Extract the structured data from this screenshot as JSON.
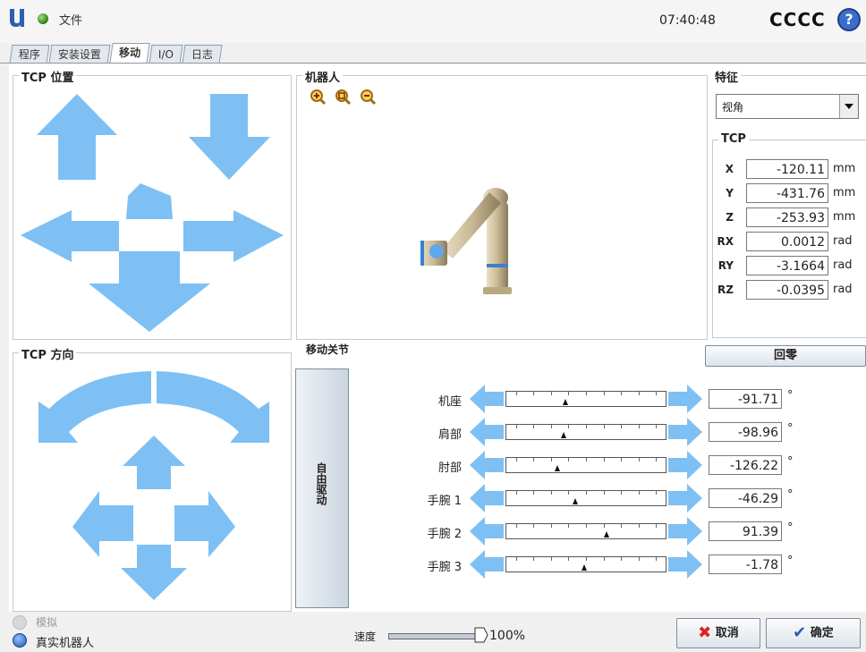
{
  "topbar": {
    "file_label": "文件",
    "clock": "07:40:48",
    "robot_name": "CCCC",
    "help_label": "?",
    "icons": {
      "logo": "ur-logo-icon",
      "status": "status-dot-icon",
      "help": "help-icon"
    }
  },
  "tabs": [
    {
      "label": "程序",
      "active": false
    },
    {
      "label": "安装设置",
      "active": false
    },
    {
      "label": "移动",
      "active": true
    },
    {
      "label": "I/O",
      "active": false
    },
    {
      "label": "日志",
      "active": false
    }
  ],
  "tcp_position": {
    "title": "TCP 位置"
  },
  "tcp_orientation": {
    "title": "TCP 方向"
  },
  "robot_view": {
    "title": "机器人",
    "zoom_icons": [
      "zoom-in-icon",
      "zoom-fit-icon",
      "zoom-out-icon"
    ]
  },
  "feature": {
    "title": "特征",
    "selected": "视角"
  },
  "tcp": {
    "title": "TCP",
    "fields": [
      {
        "label": "X",
        "value": "-120.11",
        "unit": "mm"
      },
      {
        "label": "Y",
        "value": "-431.76",
        "unit": "mm"
      },
      {
        "label": "Z",
        "value": "-253.93",
        "unit": "mm"
      },
      {
        "label": "RX",
        "value": "0.0012",
        "unit": "rad"
      },
      {
        "label": "RY",
        "value": "-3.1664",
        "unit": "rad"
      },
      {
        "label": "RZ",
        "value": "-0.0395",
        "unit": "rad"
      }
    ]
  },
  "joints": {
    "title": "移动关节",
    "home_label": "回零",
    "freedrive_label": "自由驱动",
    "degree_symbol": "°",
    "rows": [
      {
        "label": "机座",
        "value": "-91.71",
        "fraction": 0.37
      },
      {
        "label": "肩部",
        "value": "-98.96",
        "fraction": 0.36
      },
      {
        "label": "肘部",
        "value": "-126.22",
        "fraction": 0.32
      },
      {
        "label": "手腕 1",
        "value": "-46.29",
        "fraction": 0.43
      },
      {
        "label": "手腕 2",
        "value": "91.39",
        "fraction": 0.63
      },
      {
        "label": "手腕 3",
        "value": "-1.78",
        "fraction": 0.49
      }
    ]
  },
  "bottom": {
    "simulation_label": "模拟",
    "real_robot_label": "真实机器人",
    "speed_label": "速度",
    "speed_value": "100%",
    "speed_fraction": 1.0,
    "cancel_label": "取消",
    "ok_label": "确定"
  },
  "colors": {
    "arrow": "#7ec0f3",
    "accent": "#3b6ec8"
  }
}
